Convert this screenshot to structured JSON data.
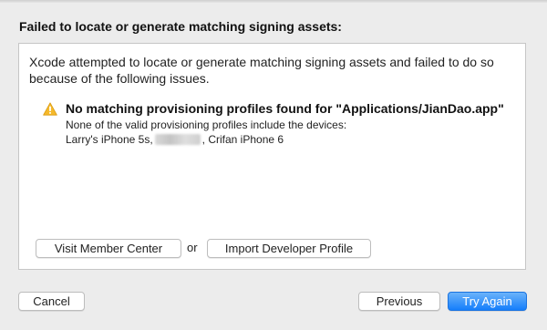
{
  "dialog": {
    "heading": "Failed to locate or generate matching signing assets:",
    "description": "Xcode attempted to locate or generate matching signing assets and failed to do so because of the following issues.",
    "issue": {
      "icon": "warning-icon",
      "title": "No matching provisioning profiles found for \"Applications/JianDao.app\"",
      "detail": "None of the valid provisioning profiles include the devices:",
      "device_first": "Larry's iPhone 5s,",
      "device_last": ", Crifan iPhone 6"
    },
    "panel_buttons": {
      "visit_label": "Visit Member Center",
      "or_label": "or",
      "import_label": "Import Developer Profile"
    },
    "footer": {
      "cancel_label": "Cancel",
      "previous_label": "Previous",
      "try_again_label": "Try Again"
    },
    "colors": {
      "accent": "#157efb",
      "warning": "#f5b92b",
      "background": "#ececec"
    }
  }
}
